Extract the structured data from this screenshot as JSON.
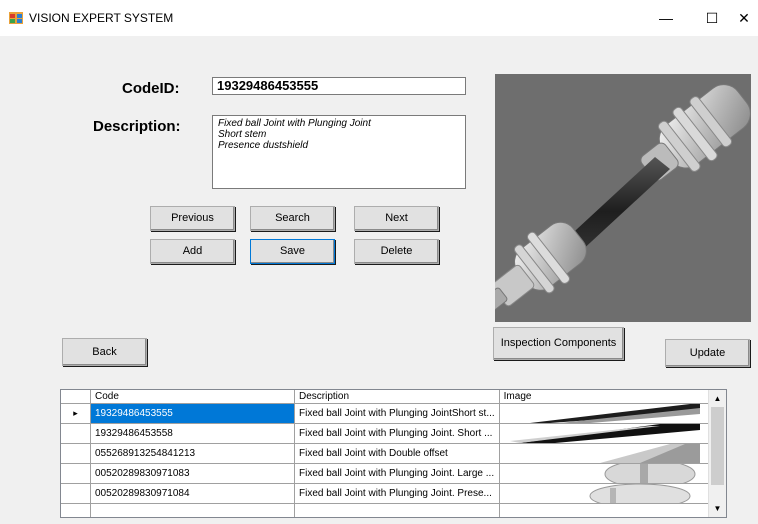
{
  "window": {
    "title": "VISION EXPERT SYSTEM",
    "minimize_glyph": "—",
    "maximize_glyph": "☐",
    "close_glyph": "✕"
  },
  "form": {
    "code_label": "CodeID:",
    "code_value": "19329486453555",
    "description_label": "Description:",
    "description_lines": [
      "Fixed ball Joint with Plunging Joint",
      "Short stem",
      "Presence dustshield"
    ]
  },
  "buttons": {
    "previous": "Previous",
    "search": "Search",
    "next": "Next",
    "add": "Add",
    "save": "Save",
    "delete": "Delete",
    "back": "Back",
    "inspection": "Inspection Components",
    "update": "Update"
  },
  "grid": {
    "columns": [
      "Code",
      "Description",
      "Image"
    ],
    "rows": [
      {
        "code": "19329486453555",
        "description": "Fixed ball Joint with Plunging JointShort st...",
        "selected": true
      },
      {
        "code": "19329486453558",
        "description": "Fixed ball Joint with Plunging Joint. Short ...",
        "selected": false
      },
      {
        "code": "055268913254841213",
        "description": "Fixed ball Joint with Double offset",
        "selected": false
      },
      {
        "code": "00520289830971083",
        "description": "Fixed ball Joint with Plunging Joint. Large ...",
        "selected": false
      },
      {
        "code": "00520289830971084",
        "description": "Fixed ball Joint with Plunging Joint. Prese...",
        "selected": false
      }
    ],
    "row_indicator": "▸"
  },
  "icons": {
    "app": "app-window-icon",
    "scroll_up": "▲",
    "scroll_down": "▼"
  },
  "colors": {
    "selection": "#0078d7",
    "photo_background": "#6e6e6e"
  }
}
